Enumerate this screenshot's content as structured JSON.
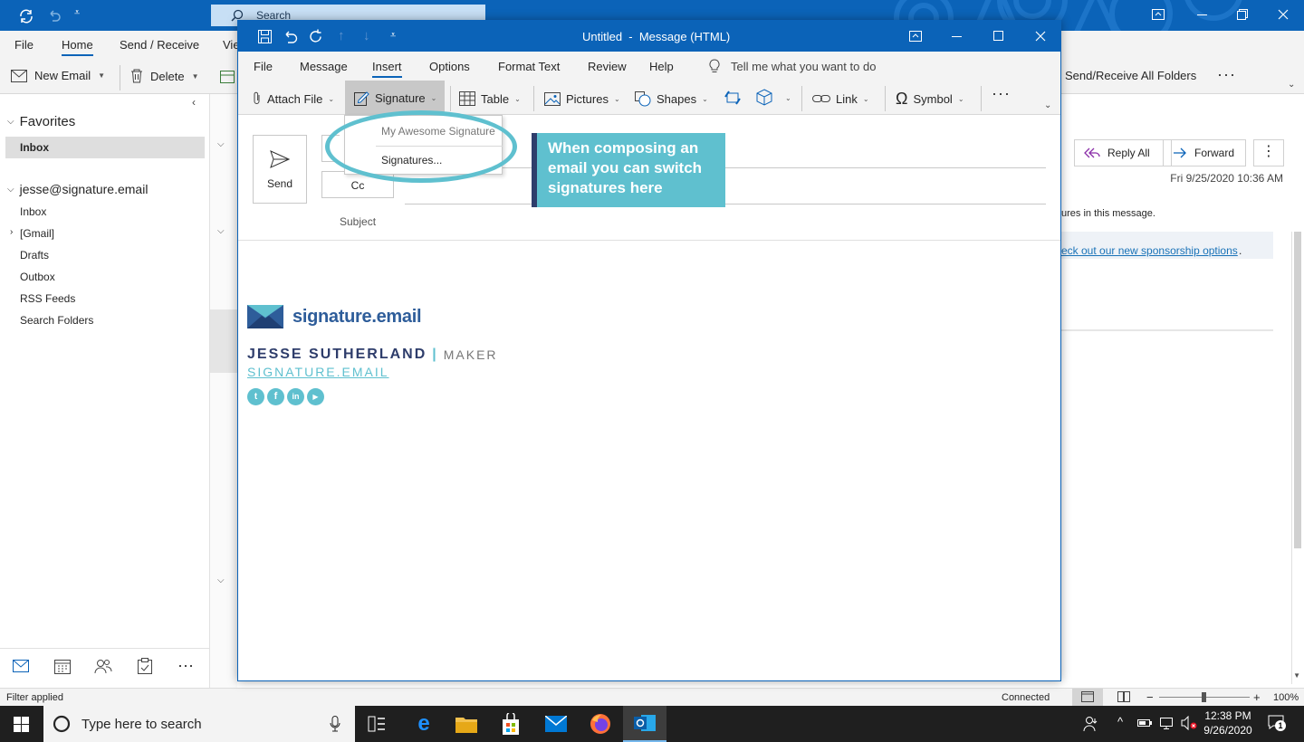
{
  "main": {
    "search_placeholder": "Search",
    "menu": [
      "File",
      "Home",
      "Send / Receive",
      "Vie"
    ],
    "ribbon": {
      "new_email": "New Email",
      "delete": "Delete",
      "send_receive_all": "Send/Receive All Folders"
    },
    "nav": {
      "favorites": "Favorites",
      "inbox_fav": "Inbox",
      "account": "jesse@signature.email",
      "folders": [
        "Inbox",
        "[Gmail]",
        "Drafts",
        "Outbox",
        "RSS Feeds",
        "Search Folders"
      ]
    },
    "reading": {
      "reply_all": "Reply All",
      "forward": "Forward",
      "date": "Fri 9/25/2020 10:36 AM",
      "pictures_note": "ures in this message.",
      "link": "eck out our new sponsorship options",
      "link_suffix": "."
    },
    "status": {
      "filter": "Filter applied",
      "connected": "Connected",
      "zoom": "100%"
    }
  },
  "compose": {
    "title": "Untitled  -  Message (HTML)",
    "menu": [
      "File",
      "Message",
      "Insert",
      "Options",
      "Format Text",
      "Review",
      "Help"
    ],
    "tell_me": "Tell me what you want to do",
    "ribbon": {
      "attach": "Attach File",
      "signature": "Signature",
      "table": "Table",
      "pictures": "Pictures",
      "shapes": "Shapes",
      "link": "Link",
      "symbol": "Symbol"
    },
    "send": "Send",
    "cc": "Cc",
    "subject": "Subject",
    "dropdown": {
      "item1": "My Awesome Signature",
      "item2": "Signatures..."
    },
    "callout": "When composing an email you can switch signatures here",
    "signature": {
      "logo_text": "signature.email",
      "name": "JESSE SUTHERLAND",
      "divider": "|",
      "role": "MAKER",
      "website": "SIGNATURE.EMAIL"
    }
  },
  "taskbar": {
    "search": "Type here to search",
    "time": "12:38 PM",
    "date": "9/26/2020",
    "notifications": "1"
  },
  "colors": {
    "office_blue": "#0b63b8",
    "teal": "#5fc0cf",
    "navy": "#2e3d6b"
  }
}
